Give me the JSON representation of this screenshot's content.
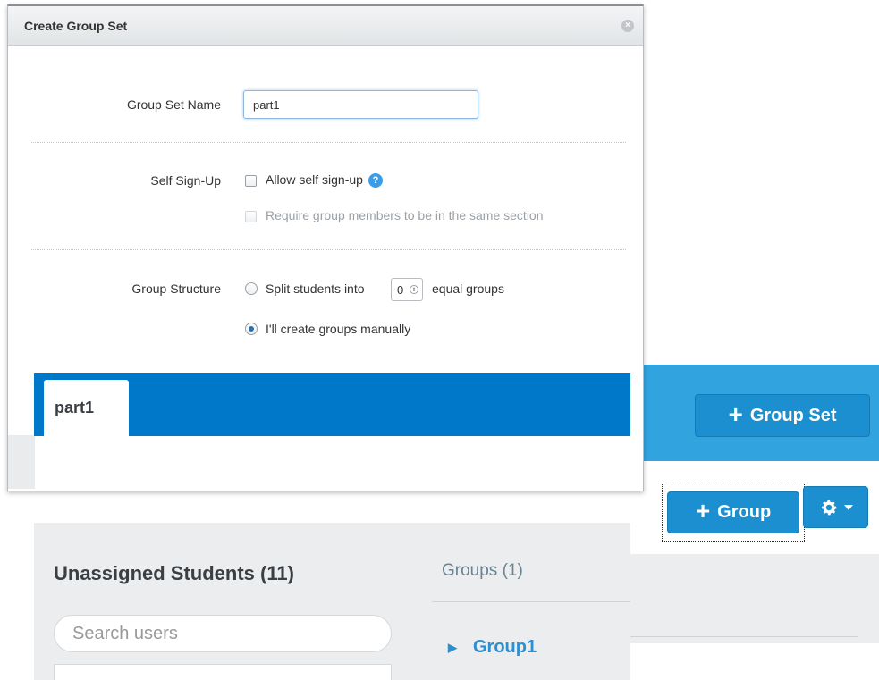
{
  "dialog": {
    "title": "Create Group Set",
    "close_glyph": "×",
    "group_set_name_label": "Group Set Name",
    "group_set_name_value": "part1",
    "self_signup_label": "Self Sign-Up",
    "allow_self_signup_text": "Allow self sign-up",
    "help_glyph": "?",
    "same_section_text": "Require group members to be in the same section",
    "group_structure_label": "Group Structure",
    "split_text_before": "Split students into",
    "split_count": "0",
    "split_text_after": "equal groups",
    "manual_text": "I'll create groups manually"
  },
  "tabs": [
    {
      "label": "part1"
    }
  ],
  "toolbar": {
    "group_set_button": "Group Set",
    "group_button": "Group",
    "plus_glyph": "+"
  },
  "unassigned": {
    "title": "Unassigned Students (11)",
    "search_placeholder": "Search users"
  },
  "groups_panel": {
    "title": "Groups (1)",
    "items": [
      {
        "label": "Group1"
      }
    ]
  },
  "colors": {
    "accent_blue": "#0078c9",
    "button_blue": "#1b8fd0",
    "link_blue": "#2b8fd0"
  }
}
